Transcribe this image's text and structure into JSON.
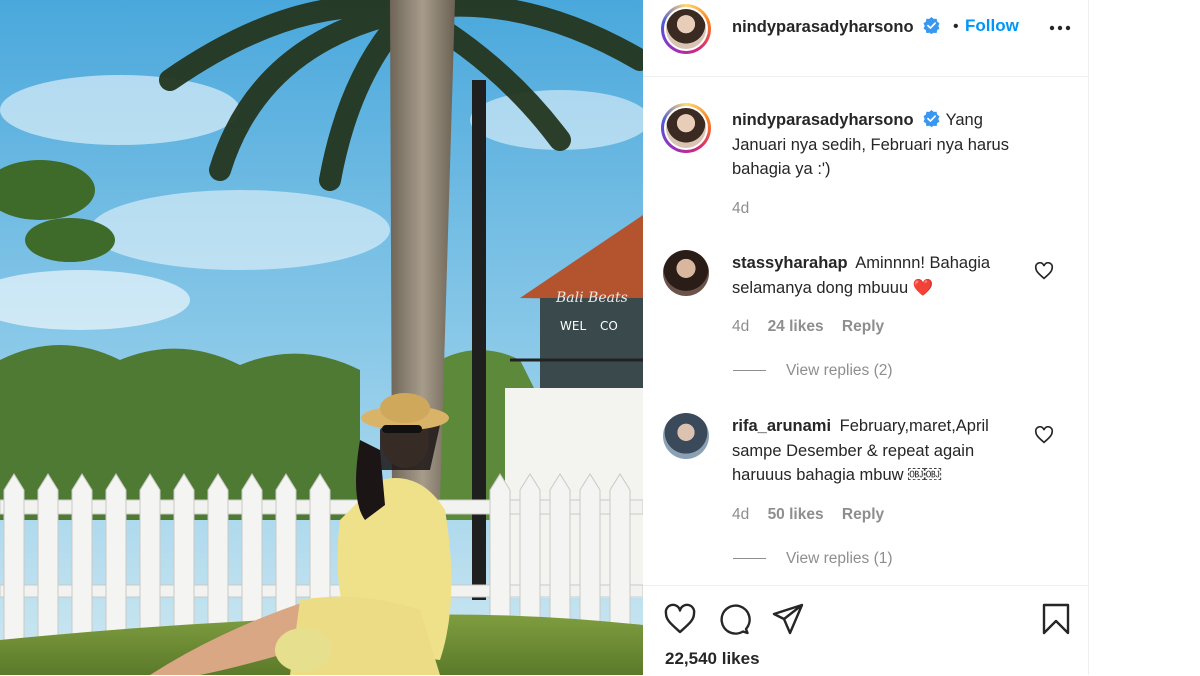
{
  "post": {
    "username": "nindyparasadyharsono",
    "follow_label": "Follow",
    "dot": "•",
    "more_icon": "more-options-icon",
    "caption": "Yang Januari nya sedih, Februari nya harus bahagia ya :')",
    "caption_time": "4d",
    "likes": "22,540 likes"
  },
  "photo": {
    "sign_text_1": "Bali Beats",
    "sign_text_2": "WEL",
    "sign_text_3": "CO"
  },
  "comments": [
    {
      "username": "stassyharahap",
      "text": "Aminnnn! Bahagia selamanya dong mbuuu ❤️",
      "time": "4d",
      "likes": "24 likes",
      "reply_label": "Reply",
      "view_replies": "View replies (2)"
    },
    {
      "username": "rifa_arunami",
      "text": "February,maret,April sampe Desember & repeat again haruuus bahagia mbuw ￼￼",
      "time": "4d",
      "likes": "50 likes",
      "reply_label": "Reply",
      "view_replies": "View replies (1)"
    }
  ],
  "colors": {
    "accent": "#0095f6",
    "verified": "#3897f0",
    "muted": "#8e8e8e",
    "text": "#262626"
  },
  "icons": [
    "verified-badge-icon",
    "heart-icon",
    "comment-icon",
    "share-icon",
    "bookmark-icon"
  ]
}
